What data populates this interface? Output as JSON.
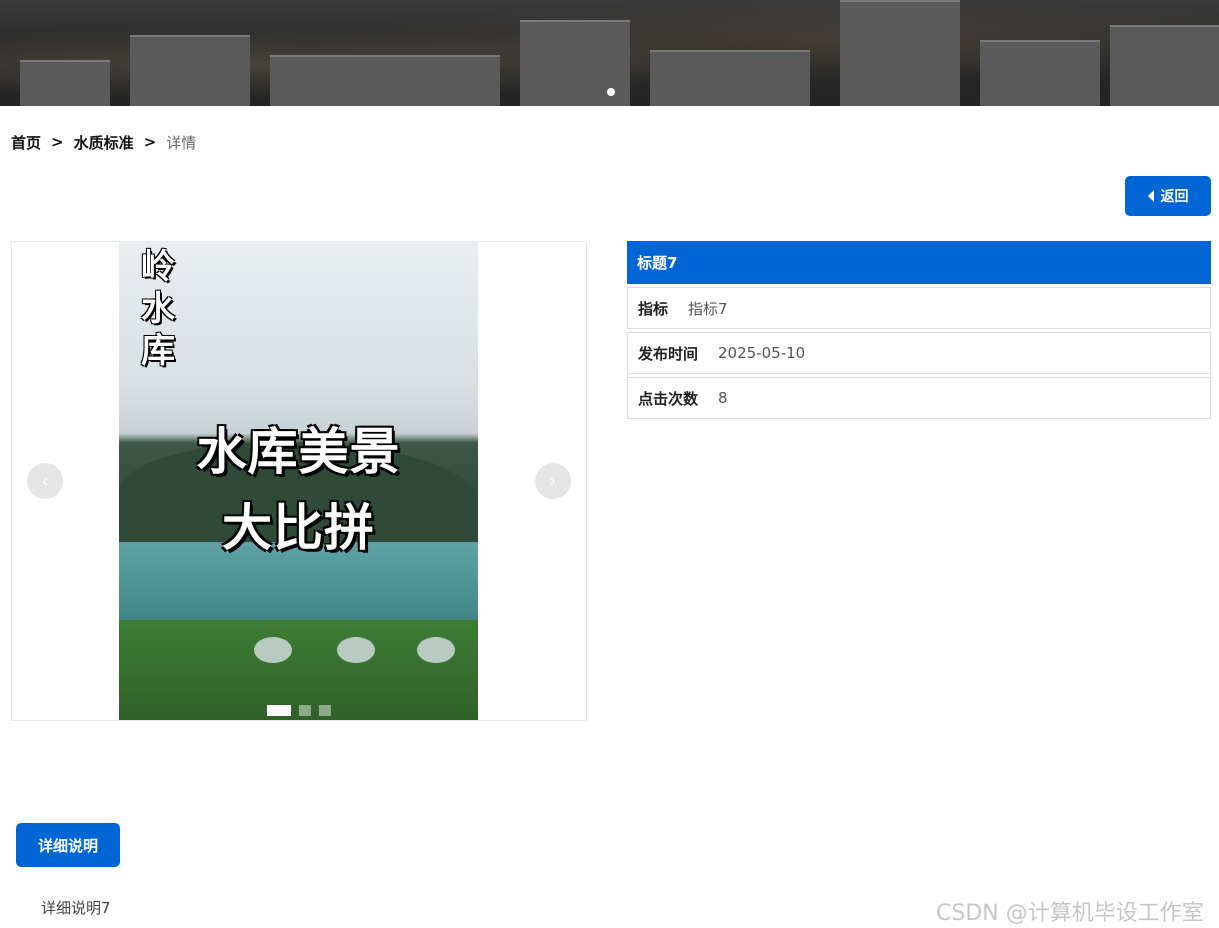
{
  "breadcrumb": {
    "home": "首页",
    "separator": ">",
    "category": "水质标准",
    "current": "详情"
  },
  "back_button": {
    "label": "返回"
  },
  "gallery": {
    "photo_text_vertical": "岭水库",
    "photo_text_line1": "水库美景",
    "photo_text_line2": "大比拼",
    "prev_label": "‹",
    "next_label": "›",
    "slide_count": 3,
    "active_slide": 1
  },
  "info": {
    "title": "标题7",
    "rows": [
      {
        "key": "指标",
        "value": "指标7"
      },
      {
        "key": "发布时间",
        "value": "2025-05-10"
      },
      {
        "key": "点击次数",
        "value": "8"
      }
    ]
  },
  "detail": {
    "button_label": "详细说明",
    "content": "详细说明7"
  },
  "watermark": "CSDN @计算机毕设工作室",
  "colors": {
    "primary": "#0066d6",
    "banner_dark": "#2a2a2a"
  }
}
